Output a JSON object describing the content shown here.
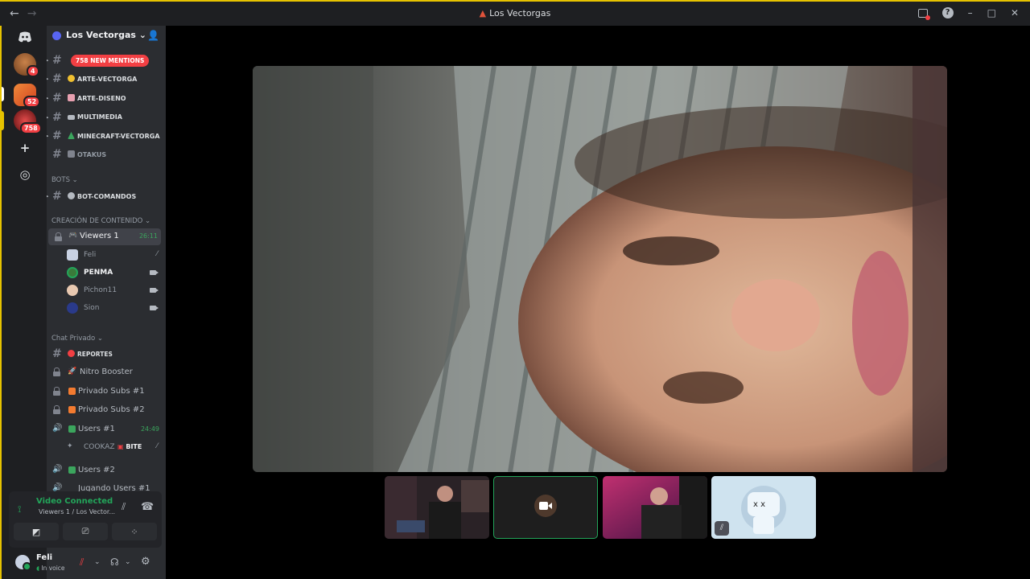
{
  "window": {
    "title": "Los Vectorgas",
    "back": "←",
    "forward": "→",
    "help": "?",
    "minimize": "–",
    "maximize": "□",
    "close": "✕"
  },
  "rail": {
    "profile_badge": "4",
    "server1_badge": "52",
    "server2_badge": "758",
    "add_glyph": "+",
    "explore_glyph": "◎"
  },
  "guild": {
    "name": "Los Vectorgas",
    "chevron": "⌄"
  },
  "mentions_pill": "758 NEW MENTIONS",
  "channels": [
    {
      "name": "ARTE-VECTORGA",
      "emoji_color": "#f0c030"
    },
    {
      "name": "ARTE-DISENO",
      "emoji_color": "#e8a0b0"
    },
    {
      "name": "MULTIMEDIA",
      "emoji_color": "#b5bac1"
    },
    {
      "name": "MINECRAFT-VECTORGA",
      "emoji_color": "#3ba55d"
    },
    {
      "name": "OTAKUS",
      "emoji_color": "#b5bac1"
    }
  ],
  "cat_bots": "BOTS ⌄",
  "bot_channel": "BOT-COMANDOS",
  "cat_content": "CREACIÓN DE CONTENIDO ⌄",
  "voice_channel": {
    "name": "Viewers 1",
    "timer": "26:11"
  },
  "voice_users": [
    {
      "name": "Feli"
    },
    {
      "name": "PENMA"
    },
    {
      "name": "Pichon11"
    },
    {
      "name": "Sion"
    }
  ],
  "cat_private": "Chat Privado ⌄",
  "private_channels": {
    "reportes": "REPORTES",
    "nitro": "Nitro Booster",
    "subs1": "Privado Subs #1",
    "subs2": "Privado Subs #2",
    "users1": "Users #1",
    "users1_timer": "24:49",
    "cookaz": "COOKAZ",
    "bite": "BITE",
    "users2": "Users #2",
    "jugando": "Jugando Users #1"
  },
  "voice_panel": {
    "title": "Video Connected",
    "subtitle": "Viewers 1 / Los Vector..."
  },
  "user_panel": {
    "name": "Feli",
    "status": "In voice"
  },
  "colors": {
    "accent": "#5865f2",
    "online": "#23a55a",
    "danger": "#f23f43"
  }
}
